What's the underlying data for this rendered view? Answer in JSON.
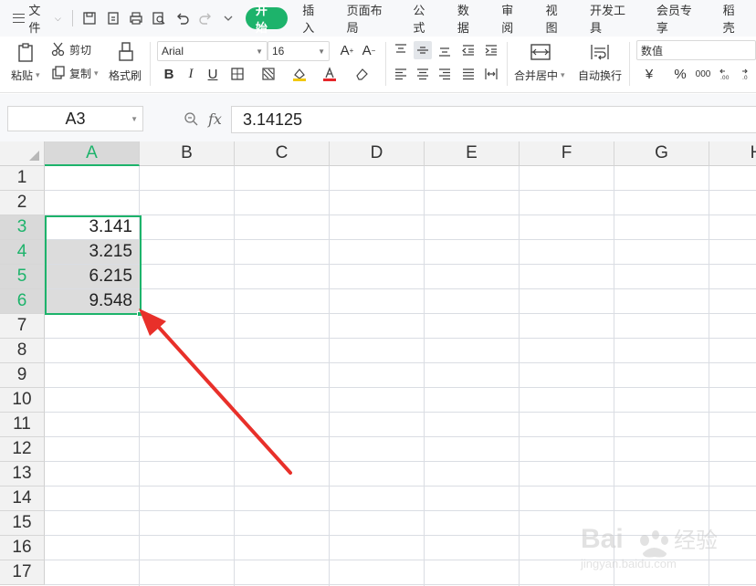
{
  "menubar": {
    "file_label": "文件",
    "tabs": [
      {
        "label": "开始",
        "active": true
      },
      {
        "label": "插入",
        "active": false
      },
      {
        "label": "页面布局",
        "active": false
      },
      {
        "label": "公式",
        "active": false
      },
      {
        "label": "数据",
        "active": false
      },
      {
        "label": "审阅",
        "active": false
      },
      {
        "label": "视图",
        "active": false
      },
      {
        "label": "开发工具",
        "active": false
      },
      {
        "label": "会员专享",
        "active": false
      },
      {
        "label": "稻壳",
        "active": false
      }
    ]
  },
  "ribbon": {
    "paste_label": "粘贴",
    "cut_label": "剪切",
    "copy_label": "复制",
    "format_painter_label": "格式刷",
    "font_name": "Arial",
    "font_size": "16",
    "bold": "B",
    "italic": "I",
    "underline": "U",
    "merge_center_label": "合并居中",
    "wrap_text_label": "自动换行",
    "number_format": "数值",
    "currency_symbol": "¥",
    "percent_symbol": "%",
    "thousands_symbol": "000"
  },
  "formula_bar": {
    "name_box": "A3",
    "fx": "fx",
    "formula": "3.14125"
  },
  "sheet": {
    "columns": [
      "A",
      "B",
      "C",
      "D",
      "E",
      "F",
      "G",
      "H"
    ],
    "rows": [
      "1",
      "2",
      "3",
      "4",
      "5",
      "6",
      "7",
      "8",
      "9",
      "10",
      "11",
      "12",
      "13",
      "14",
      "15",
      "16",
      "17"
    ],
    "cells": {
      "A3": "3.141",
      "A4": "3.215",
      "A5": "6.215",
      "A6": "9.548"
    },
    "selected_column": "A",
    "selected_rows": [
      "3",
      "4",
      "5",
      "6"
    ]
  },
  "watermark": {
    "brand": "Baidu",
    "tag": "经验",
    "url": "jingyan.baidu.com"
  },
  "colors": {
    "accent": "#1db36b",
    "arrow": "#e8302a"
  }
}
